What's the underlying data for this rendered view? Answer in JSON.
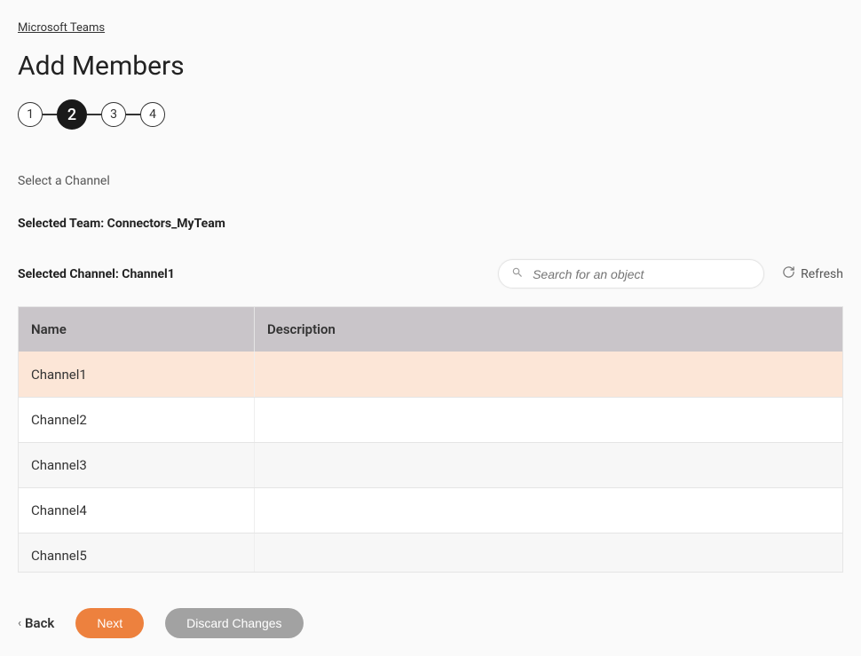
{
  "breadcrumb": "Microsoft Teams",
  "title": "Add Members",
  "steps": [
    "1",
    "2",
    "3",
    "4"
  ],
  "activeStep": 1,
  "sectionLabel": "Select a Channel",
  "selectedTeamLabel": "Selected Team: Connectors_MyTeam",
  "selectedChannelLabel": "Selected Channel: Channel1",
  "search": {
    "placeholder": "Search for an object"
  },
  "refreshLabel": "Refresh",
  "table": {
    "headers": {
      "name": "Name",
      "description": "Description"
    },
    "rows": [
      {
        "name": "Channel1",
        "description": "",
        "selected": true
      },
      {
        "name": "Channel2",
        "description": "",
        "selected": false
      },
      {
        "name": "Channel3",
        "description": "",
        "selected": false
      },
      {
        "name": "Channel4",
        "description": "",
        "selected": false
      },
      {
        "name": "Channel5",
        "description": "",
        "selected": false
      }
    ]
  },
  "footer": {
    "back": "Back",
    "next": "Next",
    "discard": "Discard Changes"
  }
}
